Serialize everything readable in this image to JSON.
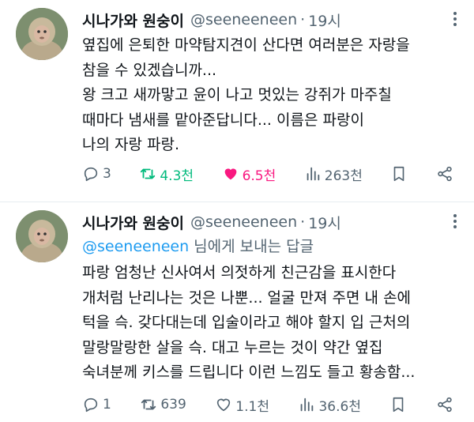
{
  "tweets": [
    {
      "author_name": "시나가와 원숭이",
      "handle": "@seeneeneen",
      "separator": "·",
      "time": "19시",
      "body_lines": [
        "옆집에 은퇴한 마약탐지견이 산다면 여러분은 자랑을",
        "참을 수 있겠습니까...",
        "왕 크고 새까맣고 윤이 나고 멋있는 강쥐가 마주칠",
        "때마다 냄새를 맡아준답니다... 이름은 파랑이",
        "나의 자랑 파랑."
      ],
      "stats": {
        "replies": "3",
        "retweets": "4.3천",
        "likes": "6.5천",
        "views": "263천"
      },
      "liked": true,
      "retweeted": true
    },
    {
      "author_name": "시나가와 원숭이",
      "handle": "@seeneeneen",
      "separator": "·",
      "time": "19시",
      "reply_mention": "@seeneeneen",
      "reply_suffix": "님에게 보내는 답글",
      "body_lines": [
        "파랑 엄청난 신사여서 의젓하게 친근감을 표시한다",
        "개처럼 난리나는 것은 나뿐... 얼굴 만져 주면 내 손에",
        "턱을 슥. 갖다대는데 입술이라고 해야 할지 입 근처의",
        "말랑말랑한 살을 슥. 대고 누르는 것이 약간 옆집",
        "숙녀분께 키스를 드립니다 이런 느낌도 들고 황송함..."
      ],
      "stats": {
        "replies": "1",
        "retweets": "639",
        "likes": "1.1천",
        "views": "36.6천"
      },
      "liked": false,
      "retweeted": false
    }
  ],
  "colors": {
    "accent": "#1d9bf0",
    "retweet": "#00ba7c",
    "like": "#f91880",
    "muted": "#536471",
    "text": "#0f1419"
  },
  "icons": [
    "more-icon",
    "reply-icon",
    "retweet-icon",
    "like-icon",
    "views-icon",
    "bookmark-icon",
    "share-icon"
  ]
}
